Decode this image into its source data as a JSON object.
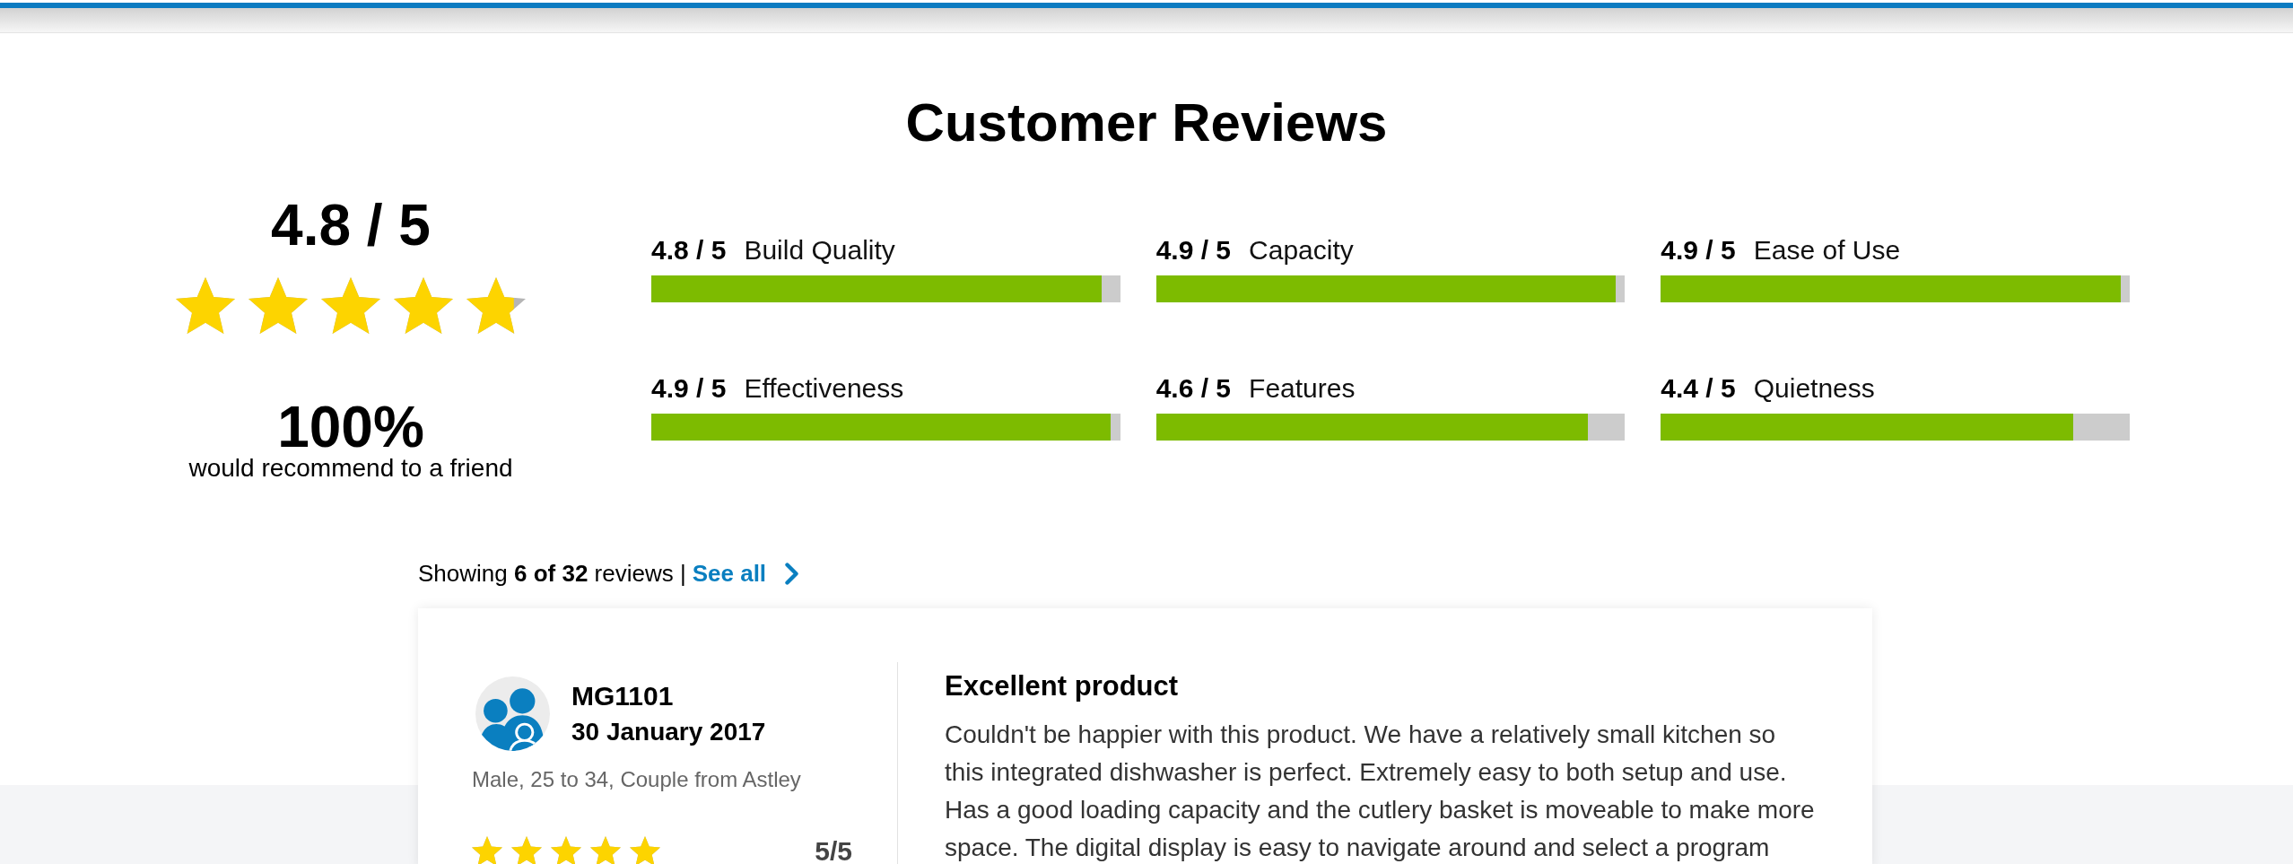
{
  "header": {
    "title": "Customer Reviews"
  },
  "overall": {
    "score": "4.8 / 5",
    "stars": 4.8,
    "recommend_percent": "100%",
    "recommend_text": "would recommend to a friend"
  },
  "categories": [
    {
      "score": "4.8 / 5",
      "name": "Build Quality",
      "level": 0.96
    },
    {
      "score": "4.9 / 5",
      "name": "Capacity",
      "level": 0.98
    },
    {
      "score": "4.9 / 5",
      "name": "Ease of Use",
      "level": 0.98
    },
    {
      "score": "4.9 / 5",
      "name": "Effectiveness",
      "level": 0.98
    },
    {
      "score": "4.6 / 5",
      "name": "Features",
      "level": 0.92
    },
    {
      "score": "4.4 / 5",
      "name": "Quietness",
      "level": 0.88
    }
  ],
  "summary": {
    "text": "Showing **6 of 32** reviews |",
    "link": "See all"
  },
  "reviews": [
    {
      "author": "MG1101",
      "date": "30 January 2017",
      "details": "Male, 25 to 34, Couple from Astley",
      "stars": 5,
      "rating": "5/5",
      "title": "Excellent product",
      "body": "Couldn't be happier with this product. We have a relatively small kitchen so this integrated dishwasher is perfect. Extremely easy to both setup and use. Has a good loading capacity and the cutlery basket is moveable to make more space. The digital display is easy to navigate around and select a program"
    }
  ]
}
